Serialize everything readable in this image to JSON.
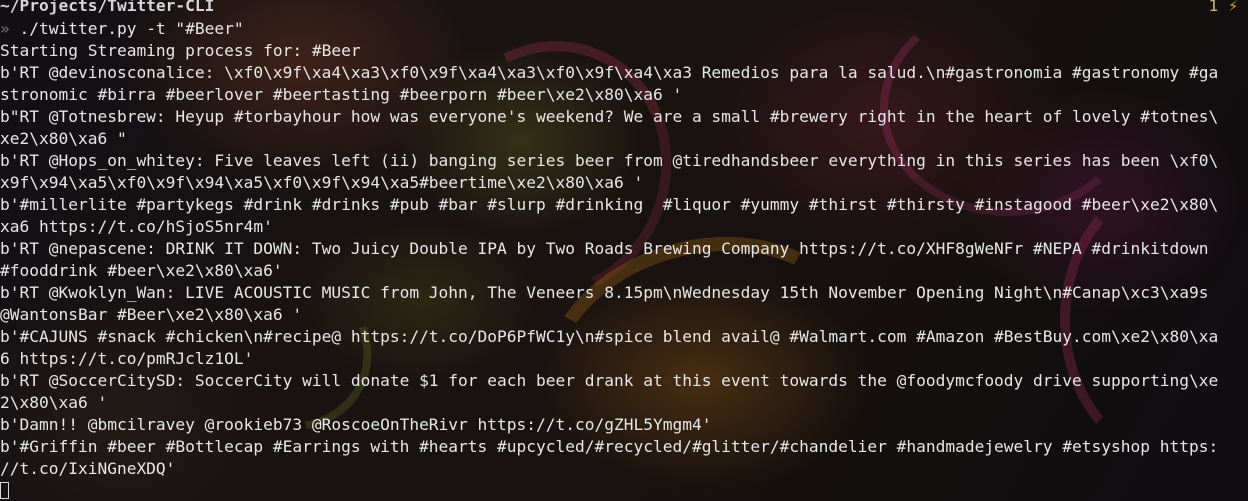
{
  "window": {
    "path": "~/Projects/Twitter-CLI",
    "status_number": "1",
    "status_icon": "lightning-icon",
    "status_glyph": "⚡"
  },
  "prompt": {
    "arrow": "»",
    "command": " ./twitter.py -t \"#Beer\""
  },
  "output_lines": [
    "Starting Streaming process for: #Beer",
    "b'RT @devinosconalice: \\xf0\\x9f\\xa4\\xa3\\xf0\\x9f\\xa4\\xa3\\xf0\\x9f\\xa4\\xa3 Remedios para la salud.\\n#gastronomia #gastronomy #ga",
    "stronomic #birra #beerlover #beertasting #beerporn #beer\\xe2\\x80\\xa6 '",
    "b\"RT @Totnesbrew: Heyup #torbayhour how was everyone's weekend? We are a small #brewery right in the heart of lovely #totnes\\",
    "xe2\\x80\\xa6 \"",
    "b'RT @Hops_on_whitey: Five leaves left (ii) banging series beer from @tiredhandsbeer everything in this series has been \\xf0\\",
    "x9f\\x94\\xa5\\xf0\\x9f\\x94\\xa5\\xf0\\x9f\\x94\\xa5#beertime\\xe2\\x80\\xa6 '",
    "b'#millerlite #partykegs #drink #drinks #pub #bar #slurp #drinking  #liquor #yummy #thirst #thirsty #instagood #beer\\xe2\\x80\\",
    "xa6 https://t.co/hSjoS5nr4m'",
    "b'RT @nepascene: DRINK IT DOWN: Two Juicy Double IPA by Two Roads Brewing Company https://t.co/XHF8gWeNFr #NEPA #drinkitdown",
    "#fooddrink #beer\\xe2\\x80\\xa6'",
    "b'RT @Kwoklyn_Wan: LIVE ACOUSTIC MUSIC from John, The Veneers 8.15pm\\nWednesday 15th November Opening Night\\n#Canap\\xc3\\xa9s",
    "@WantonsBar #Beer\\xe2\\x80\\xa6 '",
    "b'#CAJUNS #snack #chicken\\n#recipe@ https://t.co/DoP6PfWC1y\\n#spice blend avail@ #Walmart.com #Amazon #BestBuy.com\\xe2\\x80\\xa",
    "6 https://t.co/pmRJclz1OL'",
    "b'RT @SoccerCitySD: SoccerCity will donate $1 for each beer drank at this event towards the @foodymcfoody drive supporting\\xe",
    "2\\x80\\xa6 '",
    "b'Damn!! @bmcilravey @rookieb73 @RoscoeOnTheRivr https://t.co/gZHL5Ymgm4'",
    "b'#Griffin #beer #Bottlecap #Earrings with #hearts #upcycled/#recycled/#glitter/#chandelier #handmadejewelry #etsyshop https:",
    "//t.co/IxiNGneXDQ'"
  ]
}
